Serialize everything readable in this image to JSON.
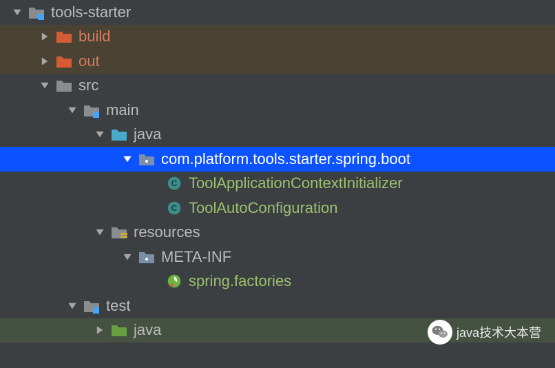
{
  "tree": {
    "root": "tools-starter",
    "build": "build",
    "out": "out",
    "src": "src",
    "main": "main",
    "java_main": "java",
    "package": "com.platform.tools.starter.spring.boot",
    "class1": "ToolApplicationContextInitializer",
    "class2": "ToolAutoConfiguration",
    "resources": "resources",
    "metainf": "META-INF",
    "factories": "spring.factories",
    "test": "test",
    "java_test": "java"
  },
  "watermark": "java技术大本营"
}
